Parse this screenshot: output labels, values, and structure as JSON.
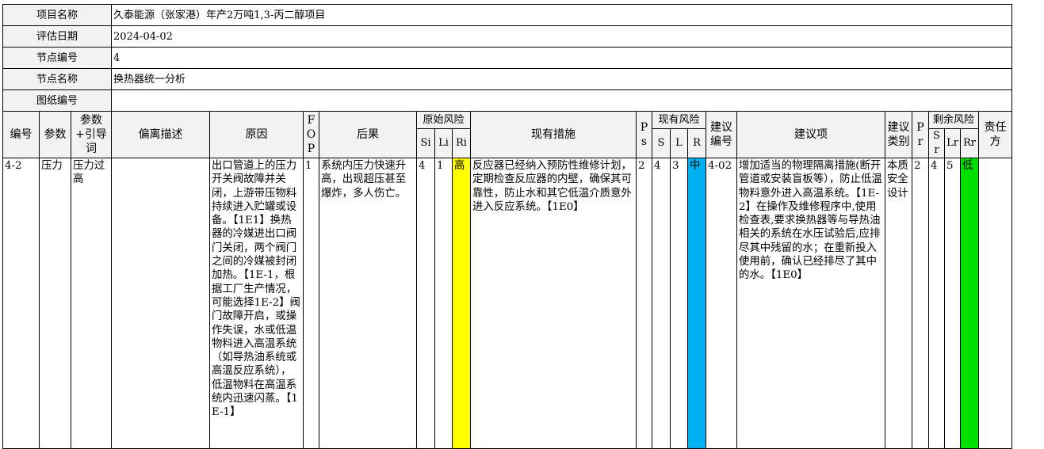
{
  "info": [
    {
      "label": "项目名称",
      "value": "久泰能源（张家港）年产2万吨1,3-丙二醇项目"
    },
    {
      "label": "评估日期",
      "value": "2024-04-02"
    },
    {
      "label": "节点编号",
      "value": "4"
    },
    {
      "label": "节点名称",
      "value": "换热器统一分析"
    },
    {
      "label": "图纸编号",
      "value": ""
    }
  ],
  "headers": {
    "no": "编号",
    "param": "参数",
    "guide": "参数+引导词",
    "deviation": "偏离描述",
    "cause": "原因",
    "fo": "FO P",
    "consequence": "后果",
    "orig_risk": "原始风险",
    "si": "Si",
    "li": "Li",
    "ri": "Ri",
    "measures": "现有措施",
    "ps": "Ps",
    "cur_risk": "现有风险",
    "s": "S",
    "l": "L",
    "r": "R",
    "sugg_no": "建议编号",
    "suggestion": "建议项",
    "sugg_type": "建议类别",
    "pr": "Pr",
    "rem_risk": "剩余风险",
    "sr": "Sr",
    "lr": "Lr",
    "rr": "Rr",
    "owner": "责任方"
  },
  "row": {
    "no": "4-2",
    "param": "压力",
    "guide": "压力过高",
    "deviation": "",
    "cause": "出口管道上的压力开关阀故障并关闭，上游带压物料持续进入贮罐或设备。【1E1】换热器的冷媒进出口阀门关闭，两个阀门之间的冷媒被封闭加热。【1E-1，根据工厂生产情况，可能选择1E-2】阀门故障开启，或操作失误，水或低温物料进入高温系统（如导热油系统或高温反应系统），低温物料在高温系统内迅速闪蒸。【1E-1】",
    "fo": "1",
    "consequence": "系统内压力快速升高，出现超压甚至爆炸，多人伤亡。",
    "si": "4",
    "li": "1",
    "ri": "高",
    "measures": "反应器已经纳入预防性维修计划，定期检查反应器的内壁，确保其可靠性，防止水和其它低温介质意外进入反应系统。【1E0】",
    "ps": "2",
    "s": "4",
    "l": "3",
    "r": "中",
    "sugg_no": "4-02",
    "suggestion": "增加适当的物理隔离措施(断开管道或安装盲板等），防止低温物料意外进入高温系统。【1E-2】在操作及维修程序中,使用检查表,要求换热器等与导热油相关的系统在水压试验后,应排尽其中残留的水；在重新投入使用前，确认已经排尽了其中的水。【1E0】",
    "sugg_type": "本质安全设计",
    "pr": "2",
    "sr": "4",
    "lr": "5",
    "rr": "低",
    "owner": ""
  },
  "colors": {
    "high": "#ffff00",
    "medium": "#00b0f0",
    "low": "#00e000"
  }
}
